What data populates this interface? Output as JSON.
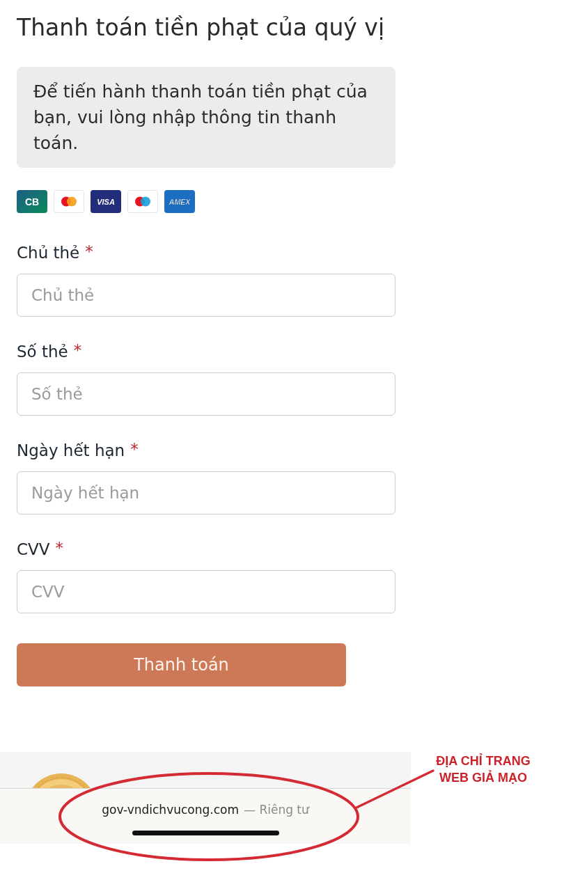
{
  "page": {
    "title": "Thanh toán tiền phạt của quý vị",
    "notice": "Để tiến hành thanh toán tiền phạt của bạn, vui lòng nhập thông tin thanh toán.",
    "card_brands": [
      {
        "kind": "cb",
        "label": "CB"
      },
      {
        "kind": "mastercard"
      },
      {
        "kind": "visa",
        "label": "VISA"
      },
      {
        "kind": "maestro"
      },
      {
        "kind": "amex",
        "label": "AMEX"
      }
    ],
    "fields": [
      {
        "label": "Chủ thẻ",
        "required_mark": "*",
        "placeholder": "Chủ thẻ"
      },
      {
        "label": "Số thẻ",
        "required_mark": "*",
        "placeholder": "Số thẻ"
      },
      {
        "label": "Ngày hết hạn",
        "required_mark": "*",
        "placeholder": "Ngày hết hạn"
      },
      {
        "label": "CVV",
        "required_mark": "*",
        "placeholder": "CVV"
      }
    ],
    "submit_button": {
      "label": "Thanh toán"
    }
  },
  "browser_bar": {
    "url": "gov-vndichvucong.com",
    "privacy": "— Riêng tư"
  },
  "annotation": {
    "callout": "ĐỊA CHỈ TRANG\nWEB GIẢ MẠO"
  }
}
